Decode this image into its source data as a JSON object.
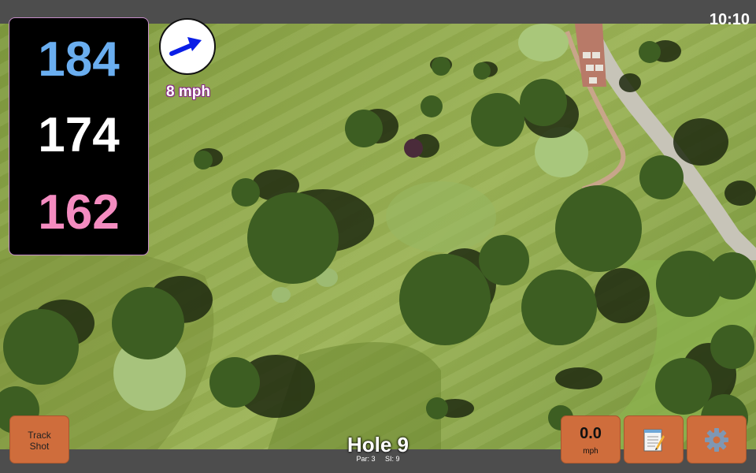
{
  "status_bar": {
    "time": "10:10"
  },
  "distances": {
    "back": "184",
    "middle": "174",
    "front": "162"
  },
  "wind": {
    "speed": "8 mph",
    "direction_icon": "wind-arrow-icon"
  },
  "hole": {
    "title": "Hole 9",
    "par": "Par: 3",
    "stroke_index": "SI: 9"
  },
  "buttons": {
    "track_shot_line1": "Track",
    "track_shot_line2": "Shot",
    "speed_value": "0.0",
    "speed_unit": "mph",
    "notes_icon": "notepad-icon",
    "settings_icon": "gear-icon"
  },
  "colors": {
    "back_distance": "#6aaef0",
    "middle_distance": "#ffffff",
    "front_distance": "#f48cc0",
    "button": "#cf6d3c",
    "wind_arrow": "#0a1ee6"
  }
}
